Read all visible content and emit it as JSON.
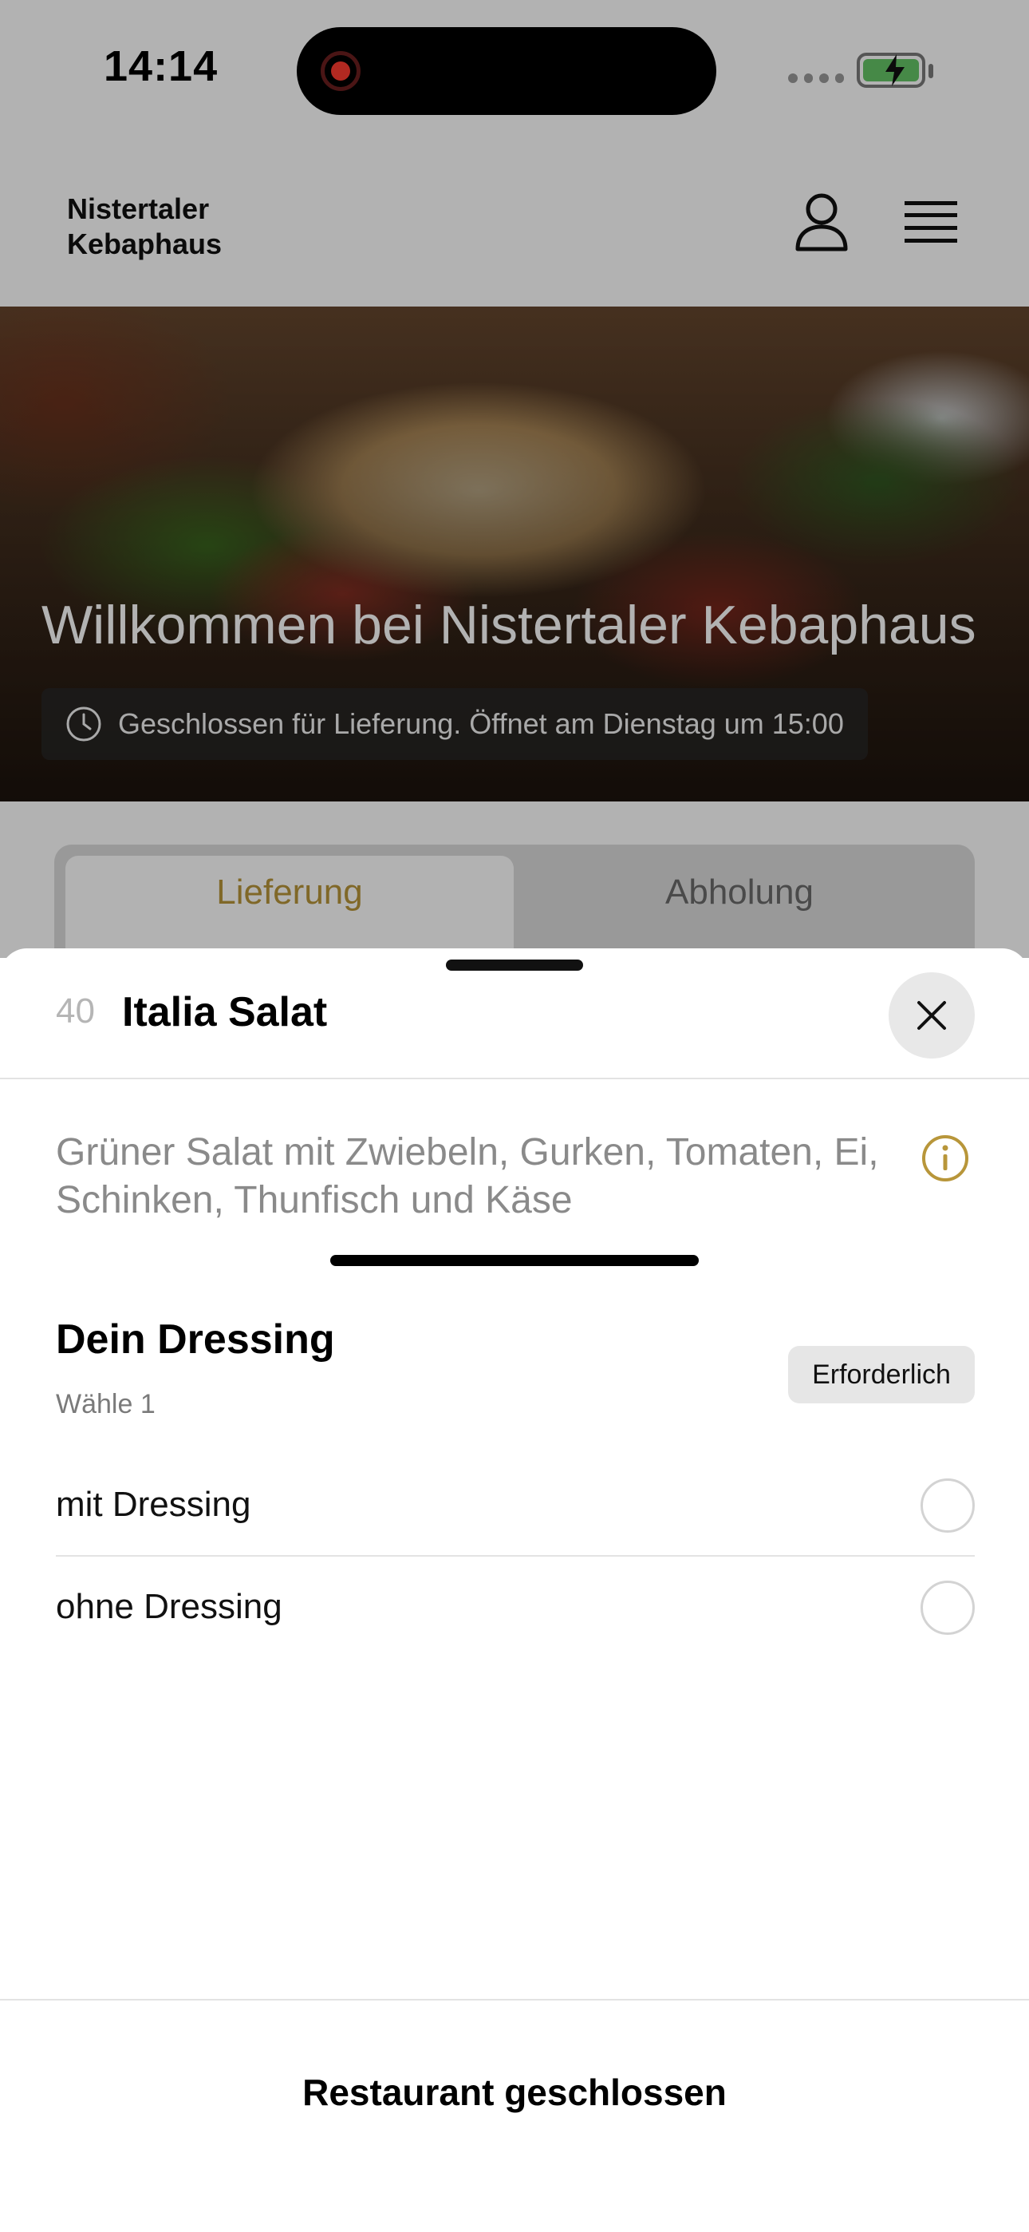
{
  "status_bar": {
    "time": "14:14",
    "icons": [
      "recording-indicator-icon",
      "signal-icon",
      "battery-charging-icon"
    ],
    "battery_color": "#65c466"
  },
  "header": {
    "brand_name": "Nistertaler Kebaphaus",
    "icons": [
      "user-icon",
      "menu-icon"
    ]
  },
  "hero": {
    "title": "Willkommen bei Nistertaler Kebaphaus",
    "status_text": "Geschlossen für Lieferung. Öffnet am Dienstag um 15:00",
    "status_icon": "clock-icon"
  },
  "order_tabs": [
    {
      "label": "Lieferung",
      "active": true
    },
    {
      "label": "Abholung",
      "active": false
    }
  ],
  "product_sheet": {
    "item_number": "40",
    "item_title": "Italia Salat",
    "description": "Grüner Salat mit Zwiebeln, Gurken, Tomaten, Ei, Schinken, Thunfisch und Käse",
    "group": {
      "title": "Dein Dressing",
      "subtitle": "Wähle 1",
      "badge": "Erforderlich",
      "options": [
        {
          "label": "mit Dressing",
          "selected": false
        },
        {
          "label": "ohne Dressing",
          "selected": false
        }
      ]
    },
    "footer_text": "Restaurant geschlossen"
  },
  "colors": {
    "accent": "#b8963a",
    "overlay": "rgba(0,0,0,0.30)"
  }
}
